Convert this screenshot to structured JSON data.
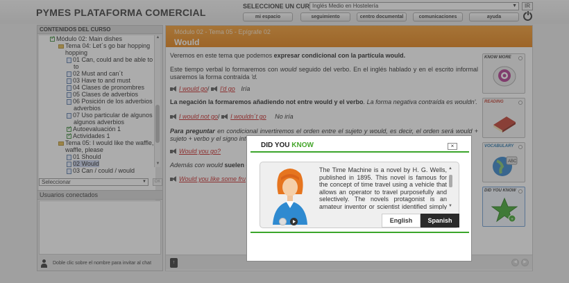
{
  "header": {
    "brand": "PYMES PLATAFORMA COMERCIAL",
    "course_label": "SELECCIONE UN CURSO:",
    "course_value": "Inglés Medio en Hostelería",
    "ir_label": "IR",
    "nav": [
      "mi espacio",
      "seguimiento",
      "centro documental",
      "comunicaciones",
      "ayuda"
    ]
  },
  "left": {
    "title": "CONTENIDOS DEL CURSO",
    "tree": [
      "Módulo 02: Main dishes",
      "Tema 04: Let´s go bar hopping",
      "01 Can, could and be able to",
      "02 Must and can´t",
      "03 Have to and must",
      "04 Clases de pronombres",
      "05 Clases de adverbios",
      "06 Posición de los adverbios",
      "07 Uso particular de algunos adverbios",
      "Autoevaluación 1",
      "Actividades 1",
      "Tema 05: I would like the waffle, please",
      "01 Should",
      "02 Would",
      "03 Can / could / would"
    ],
    "select_value": "Seleccionar",
    "ok_label": "OK",
    "users_title": "Usuarios conectados",
    "users_hint": "Doble clic sobre el nombre para invitar al chat"
  },
  "main": {
    "breadcrumb": "Módulo 02 - Tema 05 - Epígrafe 02",
    "topic": "Would",
    "p1_a": "Veremos en este tema que podemos ",
    "p1_b": "expresar condicional con la partícula would.",
    "p2_a": "Este tiempo verbal lo formaremos con ",
    "p2_would": "would",
    "p2_b": " seguido del verbo. En el inglés hablado y en el escrito informal usaremos la forma contraída ",
    "p2_d": "'d.",
    "ex1_a": "I would go",
    "ex1_sep": "/",
    "ex1_b": "I'd go",
    "ex1_tr": "Iría",
    "p3_bold": "La negación la formaremos añadiendo not entre would y el verbo",
    "p3_rest": ". La forma negativa contraída es wouldn'.",
    "ex2_a": "I would not go",
    "ex2_sep": "/",
    "ex2_b": "I wouldn´t go",
    "ex2_tr": "No iría",
    "p4_bold": "Para preguntar",
    "p4_rest": " en condicional invertiremos el orden entre el sujeto y would, es decir, el orden será would + sujeto + verbo y el signo inte",
    "ex3": "Would you go?",
    "p5_a": "Además con would ",
    "p5_bold": "suelen e",
    "ex4": "Would you like some fru"
  },
  "tools": [
    "KNOW MORE",
    "READING",
    "VOCABULARY",
    "DID YOU KNOW"
  ],
  "modal": {
    "title_a": "DID YOU ",
    "title_b": "KNOW",
    "close": "×",
    "text": "The Time Machine is a novel by H. G. Wells, published in 1895. This novel is famous for the concept of time travel using a vehicle that allows an operator to travel purposefully and selectively. The novels protagonist is an amateur inventor or scientist identified simply as The Time Traveller.",
    "tab_english": "English",
    "tab_spanish": "Spanish"
  },
  "colors": {
    "orange": "#ef8a1e",
    "green": "#3aa52a",
    "link_red": "#c51d1d"
  }
}
